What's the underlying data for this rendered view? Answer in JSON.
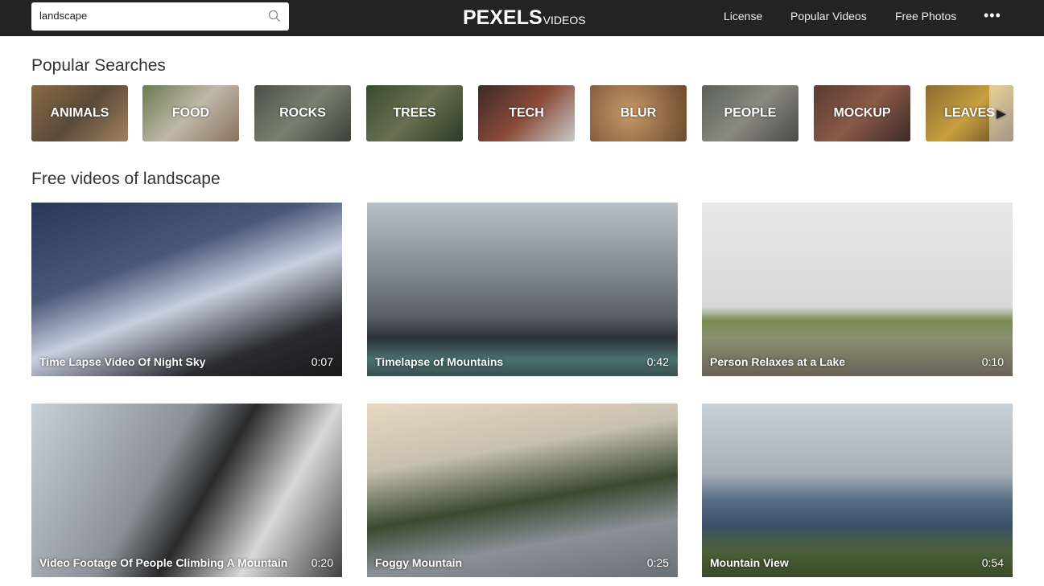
{
  "header": {
    "search_value": "landscape",
    "logo_main": "PEXELS",
    "logo_sub": "VIDEOS",
    "nav": [
      "License",
      "Popular Videos",
      "Free Photos"
    ],
    "more": "•••"
  },
  "popular": {
    "title": "Popular Searches",
    "items": [
      "ANIMALS",
      "FOOD",
      "ROCKS",
      "TREES",
      "TECH",
      "BLUR",
      "PEOPLE",
      "MOCKUP",
      "LEAVES"
    ]
  },
  "results": {
    "title": "Free videos of landscape",
    "videos": [
      {
        "title": "Time Lapse Video Of Night Sky",
        "duration": "0:07"
      },
      {
        "title": "Timelapse of Mountains",
        "duration": "0:42"
      },
      {
        "title": "Person Relaxes at a Lake",
        "duration": "0:10"
      },
      {
        "title": "Video Footage Of People Climbing A Mountain",
        "duration": "0:20"
      },
      {
        "title": "Foggy Mountain",
        "duration": "0:25"
      },
      {
        "title": "Mountain View",
        "duration": "0:54"
      }
    ]
  }
}
